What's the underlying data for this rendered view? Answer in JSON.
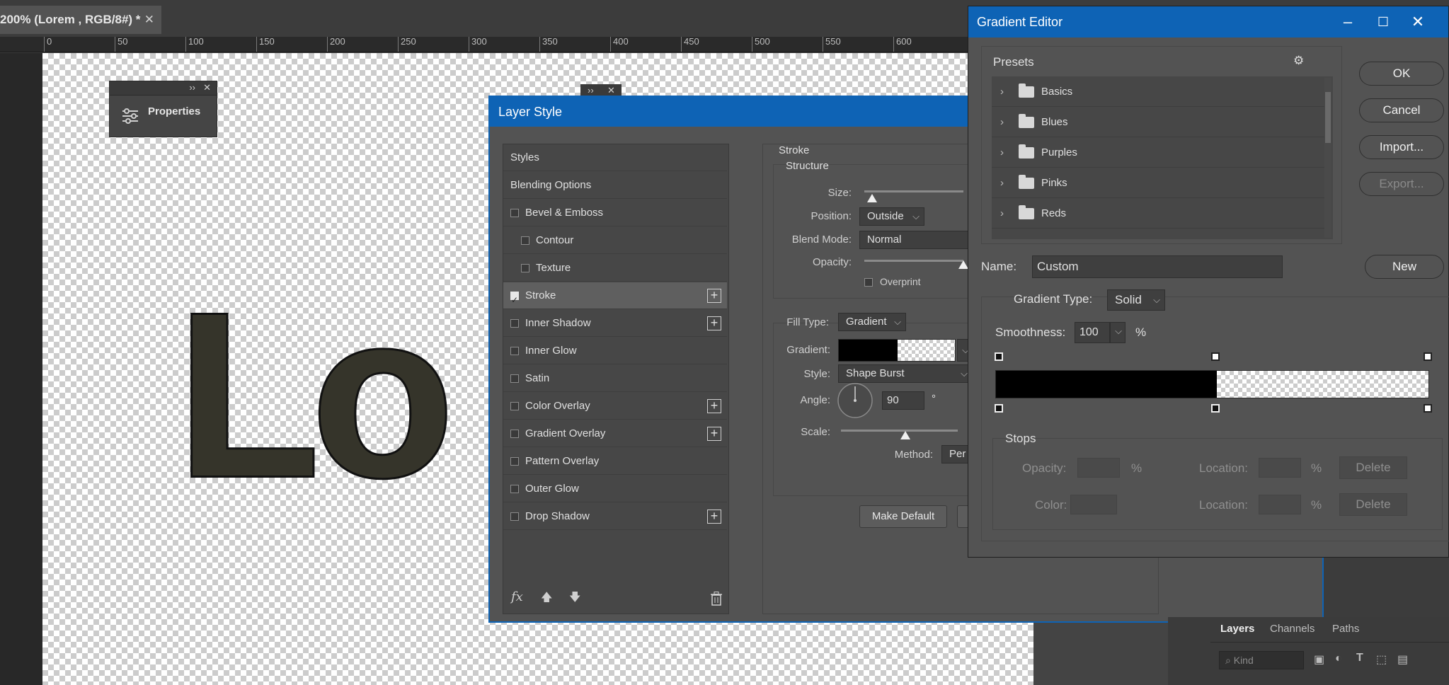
{
  "document": {
    "tab_title": "200% (Lorem , RGB/8#) *",
    "tab_close": "✕",
    "ruler_ticks": [
      "0",
      "50",
      "100",
      "150",
      "200",
      "250",
      "300",
      "350",
      "400",
      "450",
      "500",
      "550",
      "600"
    ],
    "canvas_text": "Lo"
  },
  "properties_panel": {
    "title": "Properties",
    "collapse": "››",
    "close": "✕"
  },
  "mini_panel": {
    "collapse": "››",
    "close": "✕"
  },
  "layer_style": {
    "title": "Layer Style",
    "styles": [
      {
        "label": "Styles",
        "checkbox": false,
        "plus": false,
        "indent": false
      },
      {
        "label": "Blending Options",
        "checkbox": false,
        "plus": false,
        "indent": false
      },
      {
        "label": "Bevel & Emboss",
        "checkbox": true,
        "checked": false,
        "plus": false,
        "indent": false
      },
      {
        "label": "Contour",
        "checkbox": true,
        "checked": false,
        "plus": false,
        "indent": true
      },
      {
        "label": "Texture",
        "checkbox": true,
        "checked": false,
        "plus": false,
        "indent": true
      },
      {
        "label": "Stroke",
        "checkbox": true,
        "checked": true,
        "plus": true,
        "indent": false,
        "selected": true
      },
      {
        "label": "Inner Shadow",
        "checkbox": true,
        "checked": false,
        "plus": true,
        "indent": false
      },
      {
        "label": "Inner Glow",
        "checkbox": true,
        "checked": false,
        "plus": false,
        "indent": false
      },
      {
        "label": "Satin",
        "checkbox": true,
        "checked": false,
        "plus": false,
        "indent": false
      },
      {
        "label": "Color Overlay",
        "checkbox": true,
        "checked": false,
        "plus": true,
        "indent": false
      },
      {
        "label": "Gradient Overlay",
        "checkbox": true,
        "checked": false,
        "plus": true,
        "indent": false
      },
      {
        "label": "Pattern Overlay",
        "checkbox": true,
        "checked": false,
        "plus": false,
        "indent": false
      },
      {
        "label": "Outer Glow",
        "checkbox": true,
        "checked": false,
        "plus": false,
        "indent": false
      },
      {
        "label": "Drop Shadow",
        "checkbox": true,
        "checked": false,
        "plus": true,
        "indent": false
      }
    ],
    "fx_label": "fx",
    "stroke": {
      "section_title": "Stroke",
      "structure_title": "Structure",
      "size_label": "Size:",
      "position_label": "Position:",
      "position_value": "Outside",
      "blend_mode_label": "Blend Mode:",
      "blend_mode_value": "Normal",
      "opacity_label": "Opacity:",
      "overprint_label": "Overprint",
      "fill_type_label": "Fill Type:",
      "fill_type_value": "Gradient",
      "gradient_label": "Gradient:",
      "style_label": "Style:",
      "style_value": "Shape Burst",
      "angle_label": "Angle:",
      "angle_value": "90",
      "angle_unit": "°",
      "scale_label": "Scale:",
      "method_label": "Method:",
      "method_value": "Per",
      "make_default": "Make Default"
    }
  },
  "gradient_editor": {
    "title": "Gradient Editor",
    "presets_label": "Presets",
    "presets": [
      "Basics",
      "Blues",
      "Purples",
      "Pinks",
      "Reds"
    ],
    "buttons": {
      "ok": "OK",
      "cancel": "Cancel",
      "import": "Import...",
      "export": "Export...",
      "new": "New"
    },
    "name_label": "Name:",
    "name_value": "Custom",
    "gradient_type_label": "Gradient Type:",
    "gradient_type_value": "Solid",
    "smoothness_label": "Smoothness:",
    "smoothness_value": "100",
    "percent": "%",
    "stops_label": "Stops",
    "opacity_label": "Opacity:",
    "color_label": "Color:",
    "location_label": "Location:",
    "delete_label": "Delete",
    "color_stop_location": 0.51
  },
  "layers_panel": {
    "tabs": [
      "Layers",
      "Channels",
      "Paths"
    ],
    "kind_placeholder": "Kind"
  }
}
